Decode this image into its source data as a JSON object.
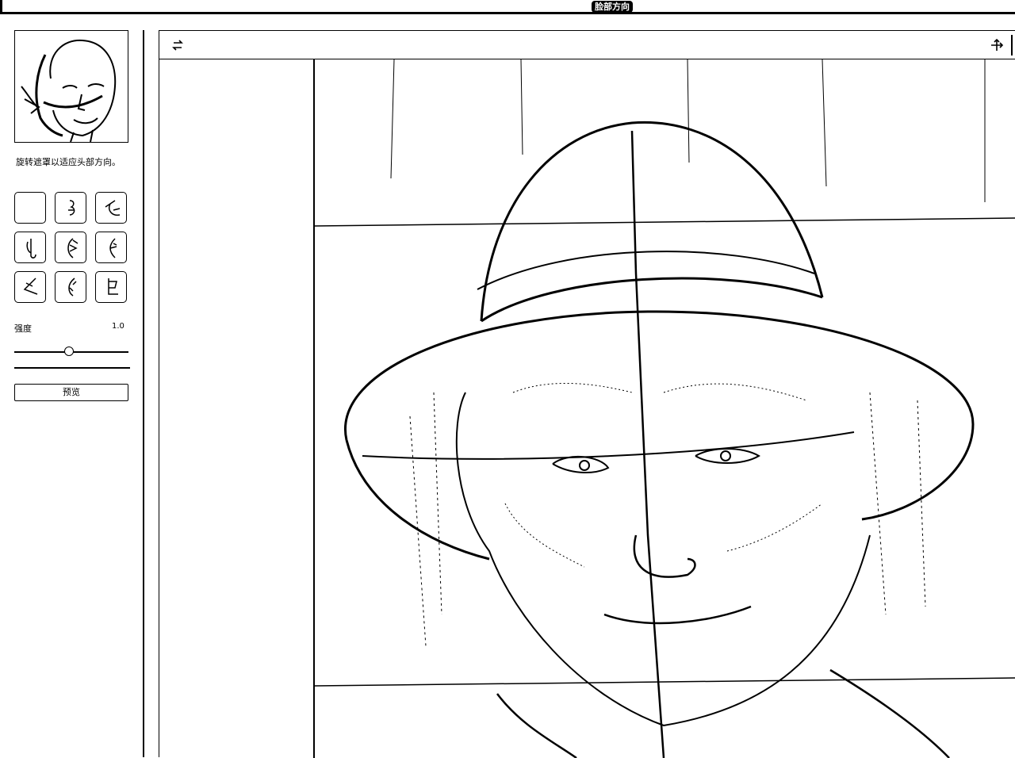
{
  "window": {
    "title": "脸部方向"
  },
  "sidebar": {
    "hint": "旋转遮罩以适应头部方向。",
    "presets": [
      {
        "name": "blank"
      },
      {
        "name": "face-front"
      },
      {
        "name": "face-up-right"
      },
      {
        "name": "face-left"
      },
      {
        "name": "face-center"
      },
      {
        "name": "face-right"
      },
      {
        "name": "face-down-left"
      },
      {
        "name": "face-down"
      },
      {
        "name": "face-down-right"
      }
    ],
    "strength": {
      "label": "强度",
      "value": "1.0",
      "level": 0.48
    },
    "preview_button": "预览"
  },
  "toolbar": {
    "reset_icon": "rotate-reset-icon",
    "pan_icon": "move-icon"
  }
}
